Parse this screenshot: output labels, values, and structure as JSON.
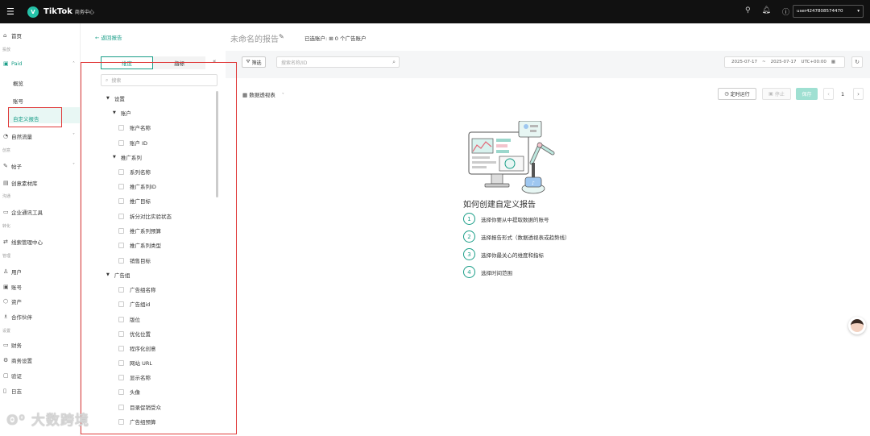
{
  "topbar": {
    "logo_letter": "V",
    "brand": "TikTok",
    "brand_sub": "商务中心",
    "user": "user4247808574470"
  },
  "sidebar": {
    "home": "首页",
    "group_ads": "投放",
    "paid": "Paid",
    "overview": "概览",
    "account": "账号",
    "custom_report": "自定义报告",
    "organic": "自然流量",
    "group_create": "创意",
    "posts": "帖子",
    "creative_library": "创意素材库",
    "group_comm": "沟通",
    "enterprise_tool": "企业通讯工具",
    "group_convert": "转化",
    "leads_center": "线索管理中心",
    "group_manage": "管理",
    "users": "用户",
    "accounts": "账号",
    "assets": "资产",
    "partners": "合作伙伴",
    "group_settings": "设置",
    "finance": "财务",
    "business_settings": "商务设置",
    "verify": "验证",
    "logs": "日志"
  },
  "panel": {
    "back": "返回报告",
    "tab_dimensions": "维度",
    "tab_metrics": "指标",
    "search_placeholder": "搜索",
    "tree": {
      "settings": "设置",
      "account_group": "账户",
      "account_name": "账户名称",
      "account_id": "账户 ID",
      "campaign_group": "推广系列",
      "campaign_name": "系列名称",
      "campaign_id": "推广系列ID",
      "campaign_objective": "推广目标",
      "split_test": "拆分对比实验状态",
      "campaign_budget": "推广系列预算",
      "campaign_type": "推广系列类型",
      "sales_objective": "销售目标",
      "adgroup_group": "广告组",
      "adgroup_name": "广告组名称",
      "adgroup_id": "广告组id",
      "placement": "版位",
      "optimization_location": "优化位置",
      "programmatic_creative": "程序化创意",
      "website_url": "网站 URL",
      "display_name": "显示名称",
      "avatar": "头像",
      "target_audience": "目录促销受众",
      "adgroup_budget": "广告组预算"
    }
  },
  "main": {
    "report_title": "未命名的报告",
    "selected_accounts": "已选账户:  ⊞ 0 个广告账户",
    "filter": "筛选",
    "search_placeholder": "搜索名称/ID",
    "date_start": "2025-07-17",
    "date_sep": "~",
    "date_end": "2025-07-17",
    "timezone": "UTC+00:00",
    "pivot": "数据透视表",
    "scheduled_run": "定时运行",
    "stop": "停止",
    "save": "保存",
    "page": "1",
    "howto_title": "如何创建自定义报告",
    "steps": [
      {
        "num": "1",
        "text": "选择你要从中提取数据的账号"
      },
      {
        "num": "2",
        "text": "选择报告形式（数据透视表或趋势线）"
      },
      {
        "num": "3",
        "text": "选择你最关心的维度和指标"
      },
      {
        "num": "4",
        "text": "选择时间范围"
      }
    ]
  },
  "watermark": "大数跨境",
  "colors": {
    "accent": "#1a9e88",
    "highlight_box": "#e03b3b",
    "topbar": "#111111"
  }
}
